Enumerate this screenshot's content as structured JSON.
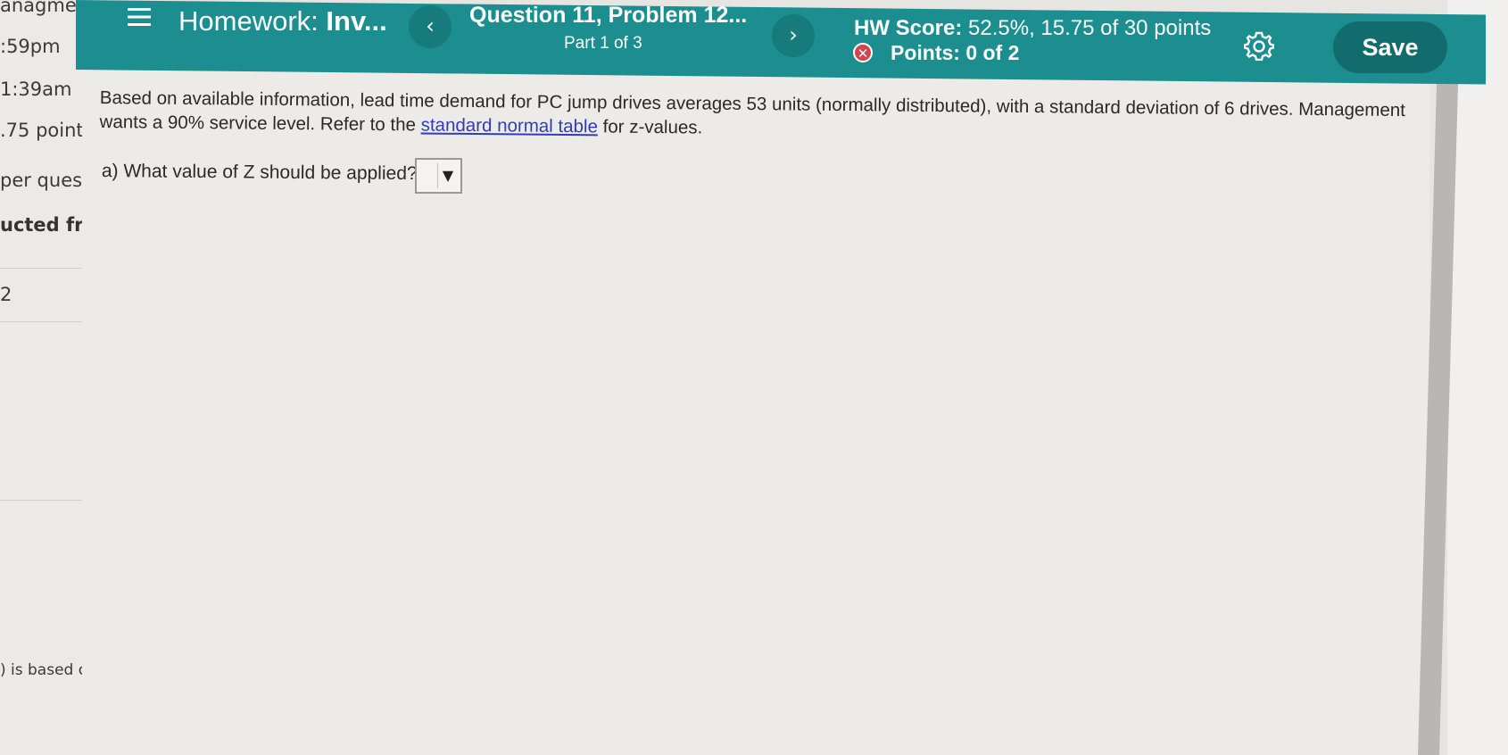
{
  "background_panel": {
    "rows": [
      "anagme",
      ":59pm",
      "1:39am",
      ".75 point",
      "per quest",
      "ucted fro",
      "2",
      ") is based on H"
    ]
  },
  "header": {
    "menu_icon": "menu-icon",
    "homework_label": "Homework:",
    "homework_name": "Inv...",
    "prev_icon": "chevron-left-icon",
    "prev_glyph": "‹",
    "question_title": "Question 11, Problem 12...",
    "part_label": "Part 1 of 3",
    "next_icon": "chevron-right-icon",
    "next_glyph": "›",
    "hw_score_label": "HW Score:",
    "hw_score_value": "52.5%, 15.75 of 30 points",
    "points_icon": "x-circle-icon",
    "points_glyph": "✕",
    "points_text": "Points: 0 of 2",
    "settings_icon": "gear-icon",
    "save_label": "Save"
  },
  "problem": {
    "text_before_link": "Based on available information, lead time demand for PC jump drives averages 53 units (normally distributed), with a standard deviation of 6 drives. Management wants a 90% service level. Refer to the ",
    "link_text": "standard normal table",
    "text_after_link": " for z-values.",
    "question_a": "a) What value of Z should be applied?",
    "answer_value": "",
    "dropdown_glyph": "▼"
  },
  "colors": {
    "header_bg": "#1c8e8f",
    "save_bg": "#126b6c",
    "link": "#2f3db8",
    "error_icon": "#d8434b"
  }
}
